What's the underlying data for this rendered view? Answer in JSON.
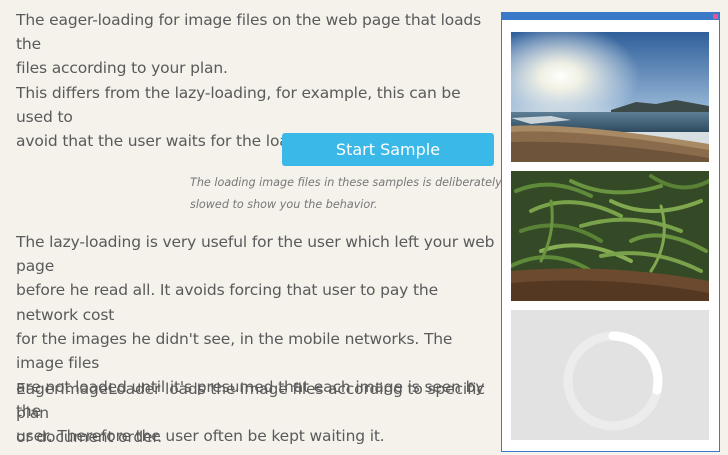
{
  "content": {
    "paragraph1": "The eager-loading for image files on the web page that loads the\nfiles according to your plan.\nThis differs from the lazy-loading, for example, this can be used to\navoid that the user waits for the loading.",
    "start_button_label": "Start Sample",
    "note": "The loading image files in these samples is deliberately\nslowed to show you the behavior.",
    "paragraph2": "The lazy-loading is very useful for the user which left your web page\nbefore he read all. It avoids forcing that user to pay the network cost\nfor the images he didn't see, in the mobile networks. The image files\nare not loaded until it's presumed that each image is seen by the\nuser. Therefore the user often be kept waiting it.",
    "paragraph3": "EagerImageLoader loads the image files according to specific plan\nor document order.\nFor example, it loads a first image file in a hurry without other"
  },
  "sample_frame": {
    "images": [
      {
        "subject": "beach-sunset-photo"
      },
      {
        "subject": "green-beans-photo"
      },
      {
        "subject": "loading-spinner",
        "loading_progress": 0.3
      }
    ],
    "accent_color": "#3a78c8",
    "close_color": "#e0569b"
  },
  "colors": {
    "button": "#3ab8e8",
    "background": "#f5f2ec"
  }
}
